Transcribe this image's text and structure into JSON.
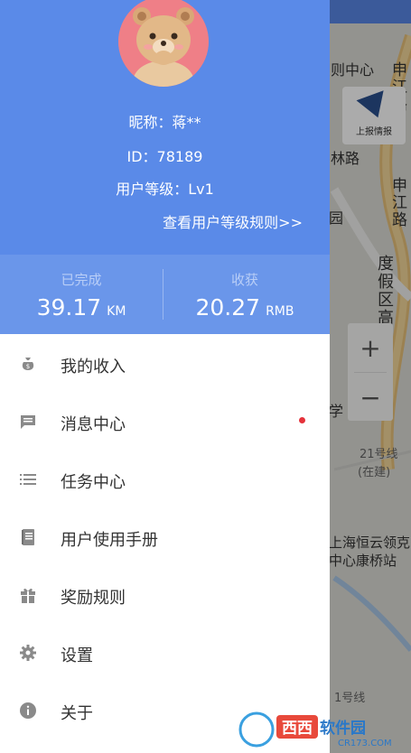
{
  "profile": {
    "nickname": "昵称：蒋**",
    "user_id": "ID：78189",
    "user_level": "用户等级：Lv1",
    "level_rules_link": "查看用户等级规则>>"
  },
  "stats": {
    "completed": {
      "label": "已完成",
      "value": "39.17",
      "unit": "KM"
    },
    "earned": {
      "label": "收获",
      "value": "20.27",
      "unit": "RMB"
    }
  },
  "menu": {
    "items": [
      {
        "label": "我的收入",
        "icon": "money-bag-icon"
      },
      {
        "label": "消息中心",
        "icon": "message-icon",
        "unread": true
      },
      {
        "label": "任务中心",
        "icon": "list-icon"
      },
      {
        "label": "用户使用手册",
        "icon": "manual-icon"
      },
      {
        "label": "奖励规则",
        "icon": "gift-icon"
      },
      {
        "label": "设置",
        "icon": "gear-icon"
      },
      {
        "label": "关于",
        "icon": "info-icon"
      }
    ]
  },
  "map": {
    "report_button": "上报情报",
    "zoom_in": "+",
    "zoom_out": "−",
    "labels": {
      "center": "则中心",
      "road_1": "申江路",
      "road_2": "林路",
      "road_3": "申江路",
      "gardens": "园",
      "highway": "度假区高",
      "xue": "学",
      "line21": "21号线",
      "building": "(在建)",
      "station_1": "上海恒云领克",
      "station_2": "中心康桥站",
      "line1": "1号线"
    }
  },
  "watermark": {
    "brand": "西西软件园",
    "url": "CR173.COM"
  },
  "colors": {
    "profile_blue": "#5a8ae8",
    "stats_blue": "#6a96ea",
    "unread_dot": "#e5323b",
    "report_arrow": "#2b4f8e"
  }
}
